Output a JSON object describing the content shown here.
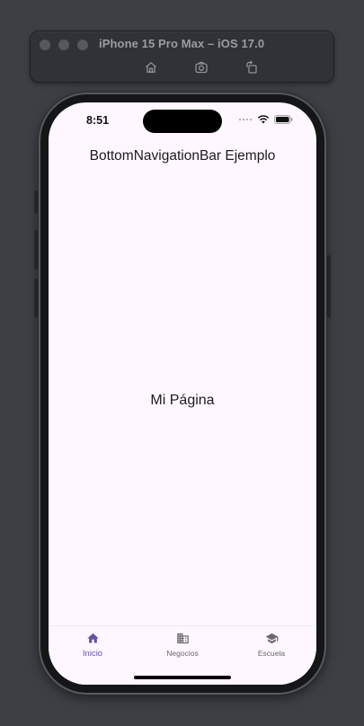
{
  "simulator": {
    "title": "iPhone 15 Pro Max – iOS 17.0",
    "tools": [
      "home-icon",
      "screenshot-icon",
      "rotate-icon"
    ]
  },
  "status_bar": {
    "time": "8:51"
  },
  "app_bar": {
    "title": "BottomNavigationBar Ejemplo"
  },
  "body": {
    "text": "Mi Página"
  },
  "bottom_nav": {
    "items": [
      {
        "label": "Inicio",
        "icon": "home-icon",
        "selected": true
      },
      {
        "label": "Negocios",
        "icon": "business-icon",
        "selected": false
      },
      {
        "label": "Escuela",
        "icon": "school-icon",
        "selected": false
      }
    ]
  },
  "colors": {
    "selected": "#6a4fa8",
    "unselected": "#6b6870",
    "background": "#fef7ff"
  }
}
